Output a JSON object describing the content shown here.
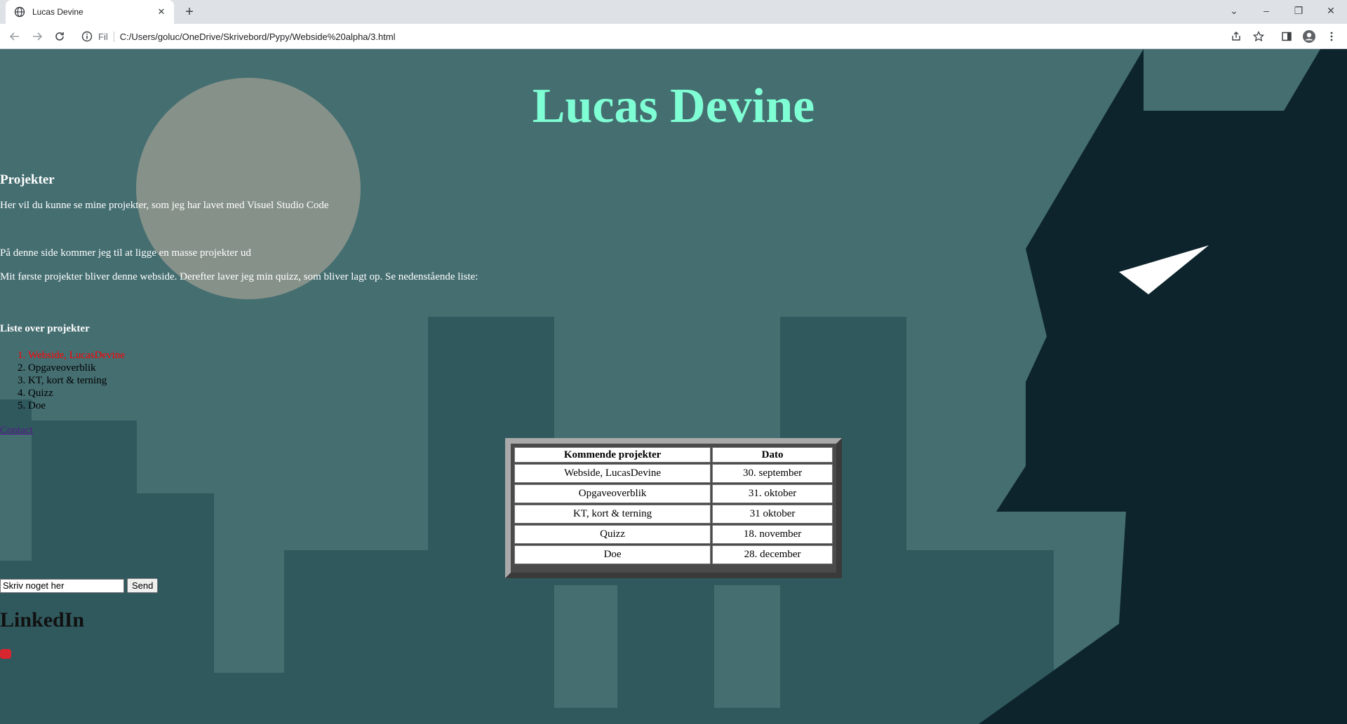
{
  "browser": {
    "tab_title": "Lucas Devine",
    "address_scheme": "Fil",
    "url": "C:/Users/goluc/OneDrive/Skrivebord/Pypy/Webside%20alpha/3.html"
  },
  "page": {
    "title": "Lucas Devine",
    "section_heading": "Projekter",
    "intro": "Her vil du kunne se mine projekter, som jeg har lavet med Visuel Studio Code",
    "para2": "På denne side kommer jeg til at ligge en masse projekter ud",
    "para3": "Mit første projekter bliver denne webside. Derefter laver jeg min quizz, som bliver lagt op. Se nedenstående liste:",
    "list_heading": "Liste over projekter",
    "list": [
      "Webside, LucasDevine",
      "Opgaveoverblik",
      "KT, kort & terning",
      "Quizz",
      "Doe"
    ],
    "contact_link": "Contact",
    "input_value": "Skriv noget her",
    "send_label": "Send",
    "linkedin_heading": "LinkedIn",
    "table": {
      "headers": [
        "Kommende projekter",
        "Dato"
      ],
      "rows": [
        [
          "Webside, LucasDevine",
          "30. september"
        ],
        [
          "Opgaveoverblik",
          "31. oktober"
        ],
        [
          "KT, kort & terning",
          "31 oktober"
        ],
        [
          "Quizz",
          "18. november"
        ],
        [
          "Doe",
          "28. december"
        ]
      ]
    }
  },
  "colors": {
    "title": "#7fffd4",
    "background": "#2f5c61",
    "moon": "#869289",
    "silhouette": "#0d242c",
    "highlight_item": "#ff0000"
  }
}
